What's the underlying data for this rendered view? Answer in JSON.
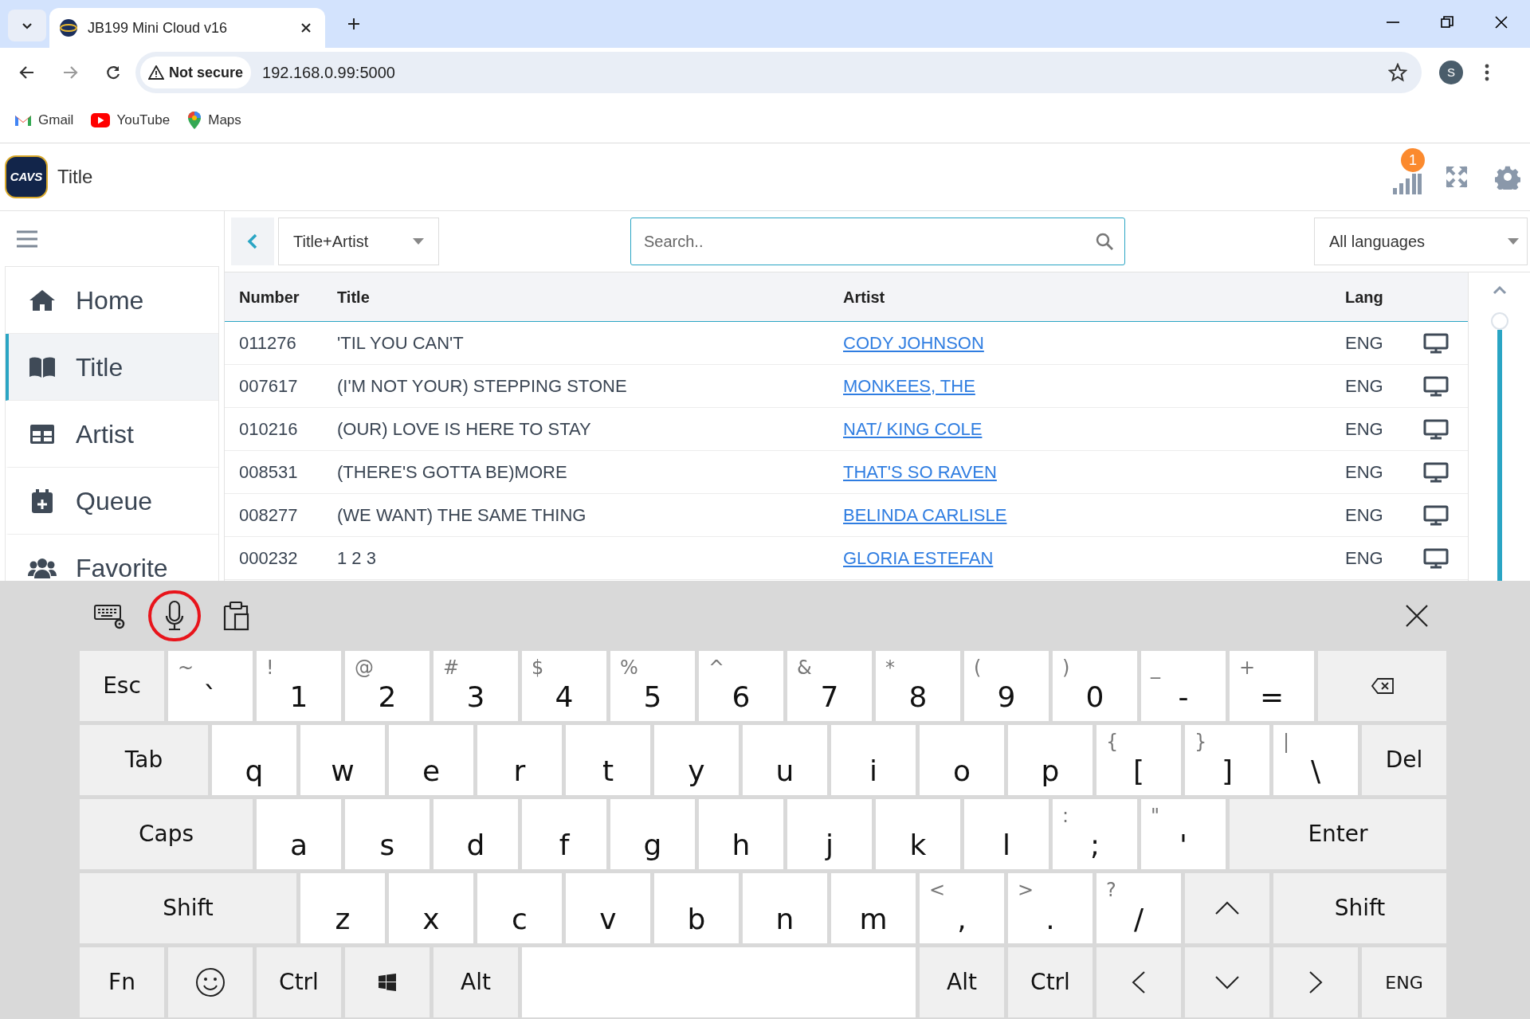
{
  "browser": {
    "tabs": [
      {
        "title": "JB199 Mini Cloud v16",
        "selected": true
      }
    ],
    "security_label": "Not secure",
    "url": "192.168.0.99:5000",
    "profile_initial": "S",
    "bookmarks": [
      {
        "label": "Gmail"
      },
      {
        "label": "YouTube"
      },
      {
        "label": "Maps"
      }
    ]
  },
  "app": {
    "logo_text": "CAVS",
    "title": "Title",
    "notification_count": "1",
    "nav": [
      {
        "label": "Home",
        "selected": false
      },
      {
        "label": "Title",
        "selected": true
      },
      {
        "label": "Artist",
        "selected": false
      },
      {
        "label": "Queue",
        "selected": false
      },
      {
        "label": "Favorite",
        "selected": false
      }
    ],
    "search_mode": "Title+Artist",
    "search": {
      "placeholder": "Search.."
    },
    "language_filter": "All languages",
    "table": {
      "columns": [
        "Number",
        "Title",
        "Artist",
        "Lang"
      ],
      "rows": [
        {
          "number": "011276",
          "title": "'TIL YOU CAN'T",
          "artist": "CODY JOHNSON",
          "lang": "ENG"
        },
        {
          "number": "007617",
          "title": "(I'M NOT YOUR) STEPPING STONE",
          "artist": "MONKEES, THE",
          "lang": "ENG"
        },
        {
          "number": "010216",
          "title": "(OUR) LOVE IS HERE TO STAY",
          "artist": "NAT/ KING COLE",
          "lang": "ENG"
        },
        {
          "number": "008531",
          "title": "(THERE'S GOTTA BE)MORE",
          "artist": "THAT'S SO RAVEN",
          "lang": "ENG"
        },
        {
          "number": "008277",
          "title": "(WE WANT) THE SAME THING",
          "artist": "BELINDA CARLISLE",
          "lang": "ENG"
        },
        {
          "number": "000232",
          "title": "1 2 3",
          "artist": "GLORIA ESTEFAN",
          "lang": "ENG"
        }
      ]
    }
  },
  "keyboard": {
    "mic_highlighted": true,
    "rows": [
      {
        "keys": [
          {
            "kind": "func",
            "label": "Esc"
          },
          {
            "kind": "char",
            "label": "`",
            "shift": "~"
          },
          {
            "kind": "char",
            "label": "1",
            "shift": "!"
          },
          {
            "kind": "char",
            "label": "2",
            "shift": "@"
          },
          {
            "kind": "char",
            "label": "3",
            "shift": "#"
          },
          {
            "kind": "char",
            "label": "4",
            "shift": "$"
          },
          {
            "kind": "char",
            "label": "5",
            "shift": "%"
          },
          {
            "kind": "char",
            "label": "6",
            "shift": "^"
          },
          {
            "kind": "char",
            "label": "7",
            "shift": "&"
          },
          {
            "kind": "char",
            "label": "8",
            "shift": "*"
          },
          {
            "kind": "char",
            "label": "9",
            "shift": "("
          },
          {
            "kind": "char",
            "label": "0",
            "shift": ")"
          },
          {
            "kind": "char",
            "label": "-",
            "shift": "_"
          },
          {
            "kind": "char",
            "label": "=",
            "shift": "+"
          },
          {
            "kind": "backspace"
          }
        ]
      },
      {
        "keys": [
          {
            "kind": "func",
            "label": "Tab"
          },
          {
            "kind": "char",
            "label": "q"
          },
          {
            "kind": "char",
            "label": "w"
          },
          {
            "kind": "char",
            "label": "e"
          },
          {
            "kind": "char",
            "label": "r"
          },
          {
            "kind": "char",
            "label": "t"
          },
          {
            "kind": "char",
            "label": "y"
          },
          {
            "kind": "char",
            "label": "u"
          },
          {
            "kind": "char",
            "label": "i"
          },
          {
            "kind": "char",
            "label": "o"
          },
          {
            "kind": "char",
            "label": "p"
          },
          {
            "kind": "char",
            "label": "[",
            "shift": "{"
          },
          {
            "kind": "char",
            "label": "]",
            "shift": "}"
          },
          {
            "kind": "char",
            "label": "\\",
            "shift": "|"
          },
          {
            "kind": "func",
            "label": "Del"
          }
        ]
      },
      {
        "keys": [
          {
            "kind": "func",
            "label": "Caps"
          },
          {
            "kind": "char",
            "label": "a"
          },
          {
            "kind": "char",
            "label": "s"
          },
          {
            "kind": "char",
            "label": "d"
          },
          {
            "kind": "char",
            "label": "f"
          },
          {
            "kind": "char",
            "label": "g"
          },
          {
            "kind": "char",
            "label": "h"
          },
          {
            "kind": "char",
            "label": "j"
          },
          {
            "kind": "char",
            "label": "k"
          },
          {
            "kind": "char",
            "label": "l"
          },
          {
            "kind": "char",
            "label": ";",
            "shift": ":"
          },
          {
            "kind": "char",
            "label": "'",
            "shift": "\""
          },
          {
            "kind": "func",
            "label": "Enter"
          }
        ]
      },
      {
        "keys": [
          {
            "kind": "func",
            "label": "Shift"
          },
          {
            "kind": "char",
            "label": "z"
          },
          {
            "kind": "char",
            "label": "x"
          },
          {
            "kind": "char",
            "label": "c"
          },
          {
            "kind": "char",
            "label": "v"
          },
          {
            "kind": "char",
            "label": "b"
          },
          {
            "kind": "char",
            "label": "n"
          },
          {
            "kind": "char",
            "label": "m"
          },
          {
            "kind": "char",
            "label": ",",
            "shift": "<"
          },
          {
            "kind": "char",
            "label": ".",
            "shift": ">"
          },
          {
            "kind": "char",
            "label": "/",
            "shift": "?"
          },
          {
            "kind": "up"
          },
          {
            "kind": "func",
            "label": "Shift"
          }
        ]
      },
      {
        "keys": [
          {
            "kind": "func",
            "label": "Fn"
          },
          {
            "kind": "emoji"
          },
          {
            "kind": "func",
            "label": "Ctrl"
          },
          {
            "kind": "windows"
          },
          {
            "kind": "func",
            "label": "Alt"
          },
          {
            "kind": "space"
          },
          {
            "kind": "func",
            "label": "Alt"
          },
          {
            "kind": "func",
            "label": "Ctrl"
          },
          {
            "kind": "left"
          },
          {
            "kind": "down"
          },
          {
            "kind": "right"
          },
          {
            "kind": "lang",
            "label": "ENG"
          }
        ]
      }
    ]
  }
}
